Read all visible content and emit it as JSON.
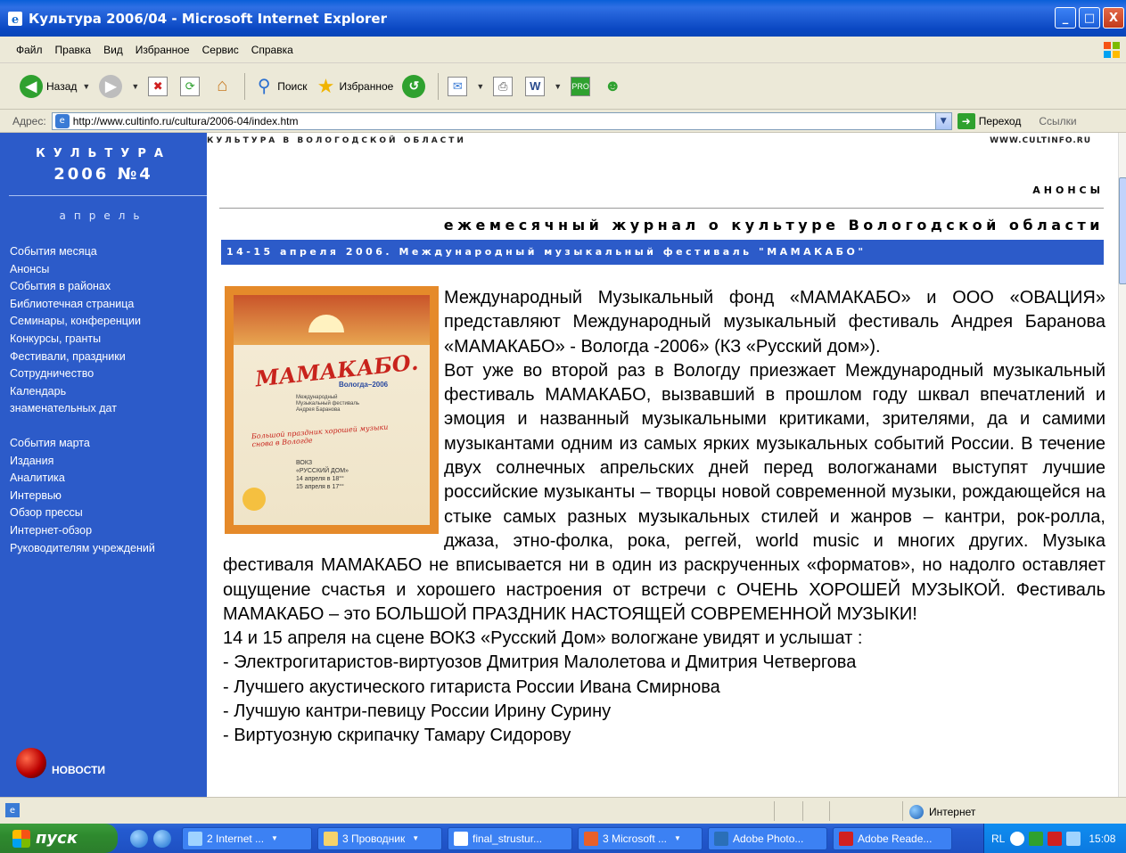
{
  "window": {
    "title": "Культура 2006/04 - Microsoft Internet Explorer",
    "buttons": {
      "minimize": "_",
      "maximize": "□",
      "close": "X"
    }
  },
  "menu": [
    "Файл",
    "Правка",
    "Вид",
    "Избранное",
    "Сервис",
    "Справка"
  ],
  "toolbar": {
    "back": "Назад",
    "search": "Поиск",
    "favorites": "Избранное"
  },
  "address": {
    "label": "Адрес:",
    "url": "http://www.cultinfo.ru/cultura/2006-04/index.htm",
    "go": "Переход",
    "links": "Ссылки"
  },
  "sidebar": {
    "magazine": "КУЛЬТУРА",
    "issue": "2006 №4",
    "month": "апрель",
    "nav_group1": [
      "События месяца",
      "Анонсы",
      "События в районах",
      "Библиотечная страница",
      "Семинары, конференции",
      "Конкурсы, гранты",
      "Фестивали, праздники",
      "Сотрудничество",
      "Календарь",
      "знаменательных дат"
    ],
    "nav_group2": [
      "События марта",
      "Издания",
      "Аналитика",
      "Интервью",
      "Обзор прессы",
      "Интернет-обзор",
      "Руководителям учреждений"
    ],
    "news": "НОВОСТИ"
  },
  "page": {
    "header_left": "КУЛЬТУРА В ВОЛОГОДСКОЙ ОБЛАСТИ",
    "header_right": "WWW.CULTINFO.RU",
    "section": "АНОНСЫ",
    "subtitle": "ежемесячный журнал о культуре Вологодской области",
    "banner": "14-15 апреля 2006. Международный музыкальный фестиваль \"МАМАКАБО\""
  },
  "poster": {
    "logo": "МАМАКАБО.",
    "city": "Вологда–2006",
    "small": "Международный\nМузыкальный фестиваль\nАндрея Баранова",
    "red": "Большой праздник хорошей музыки снова в Вологде",
    "venue": "ВОКЗ\n«РУССКИЙ ДОМ»",
    "date1": "14 апреля в 18°°",
    "date2": "15 апреля в 17°°"
  },
  "article": {
    "p1": "Международный Музыкальный фонд «МАМАКАБО» и ООО «ОВАЦИЯ» представляют Международный музыкальный фестиваль Андрея Баранова «МАМАКАБО» - Вологда -2006» (КЗ «Русский дом»).",
    "p2": "Вот уже во второй раз в Вологду приезжает Международный музыкальный фестиваль МАМАКАБО, вызвавший в прошлом году шквал впечатлений и эмоция и названный музыкальными критиками, зрителями, да и самими музыкантами одним из самых ярких музыкальных событий России. В течение двух солнечных апрельских дней перед вологжанами выступят лучшие российские музыканты – творцы новой современной музыки, рождающейся на стыке самых разных музыкальных стилей и жанров – кантри, рок-ролла, джаза, этно-фолка, рока, реггей, world music и многих других. Музыка фестиваля МАМАКАБО не вписывается ни в один из раскрученных «форматов», но надолго оставляет ощущение счастья и хорошего настроения от встречи с ОЧЕНЬ ХОРОШЕЙ МУЗЫКОЙ. Фестиваль МАМАКАБО – это БОЛЬШОЙ ПРАЗДНИК НАСТОЯЩЕЙ СОВРЕМЕННОЙ МУЗЫКИ!",
    "p3": "14 и 15 апреля на сцене ВОКЗ «Русский Дом» вологжане увидят и услышат :",
    "items": [
      "- Электрогитаристов-виртуозов Дмитрия Малолетова и Дмитрия Четвергова",
      "- Лучшего акустического гитариста России Ивана Смирнова",
      "- Лучшую кантри-певицу России Ирину Сурину",
      "- Виртуозную скрипачку Тамару Сидорову"
    ]
  },
  "status": {
    "zone": "Интернет"
  },
  "taskbar": {
    "start": "пуск",
    "tasks": [
      "2 Internet ...",
      "3 Проводник",
      "final_strustur...",
      "3 Microsoft ...",
      "Adobe Photo...",
      "Adobe Reade..."
    ],
    "lang": "RL",
    "clock": "15:08"
  }
}
